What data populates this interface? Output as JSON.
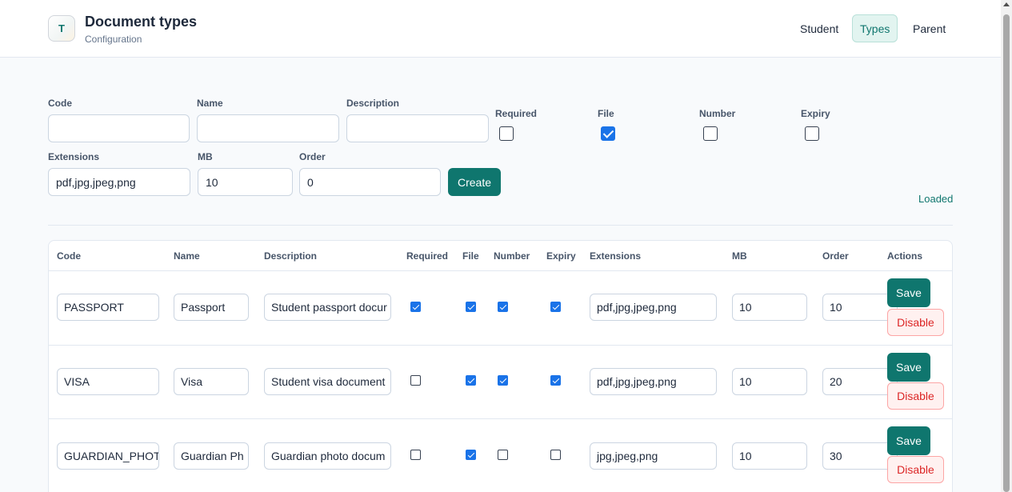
{
  "app": {
    "logo_letter": "T",
    "title": "Document types",
    "subtitle": "Configuration"
  },
  "nav": {
    "items": [
      {
        "label": "Student",
        "active": false
      },
      {
        "label": "Types",
        "active": true
      },
      {
        "label": "Parent",
        "active": false
      }
    ]
  },
  "form": {
    "code_label": "Code",
    "code_value": "",
    "name_label": "Name",
    "name_value": "",
    "description_label": "Description",
    "description_value": "",
    "required_label": "Required",
    "required_checked": false,
    "file_label": "File",
    "file_checked": true,
    "number_label": "Number",
    "number_checked": false,
    "expiry_label": "Expiry",
    "expiry_checked": false,
    "extensions_label": "Extensions",
    "extensions_value": "pdf,jpg,jpeg,png",
    "mb_label": "MB",
    "mb_value": "10",
    "order_label": "Order",
    "order_value": "0",
    "create_label": "Create",
    "status": "Loaded"
  },
  "table": {
    "headers": [
      "Code",
      "Name",
      "Description",
      "Required",
      "File",
      "Number",
      "Expiry",
      "Extensions",
      "MB",
      "Order",
      "Actions"
    ],
    "rows": [
      {
        "code": "PASSPORT",
        "name": "Passport",
        "description": "Student passport docur",
        "required": true,
        "file": true,
        "number": true,
        "expiry": true,
        "extensions": "pdf,jpg,jpeg,png",
        "mb": "10",
        "order": "10"
      },
      {
        "code": "VISA",
        "name": "Visa",
        "description": "Student visa document",
        "required": false,
        "file": true,
        "number": true,
        "expiry": true,
        "extensions": "pdf,jpg,jpeg,png",
        "mb": "10",
        "order": "20"
      },
      {
        "code": "GUARDIAN_PHOT",
        "name": "Guardian Ph",
        "description": "Guardian photo docum",
        "required": false,
        "file": true,
        "number": false,
        "expiry": false,
        "extensions": "jpg,jpeg,png",
        "mb": "10",
        "order": "30"
      }
    ],
    "save_label": "Save",
    "disable_label": "Disable"
  },
  "colors": {
    "accent": "#0f766e",
    "checkbox": "#1a73e8",
    "danger": "#dc2626"
  }
}
